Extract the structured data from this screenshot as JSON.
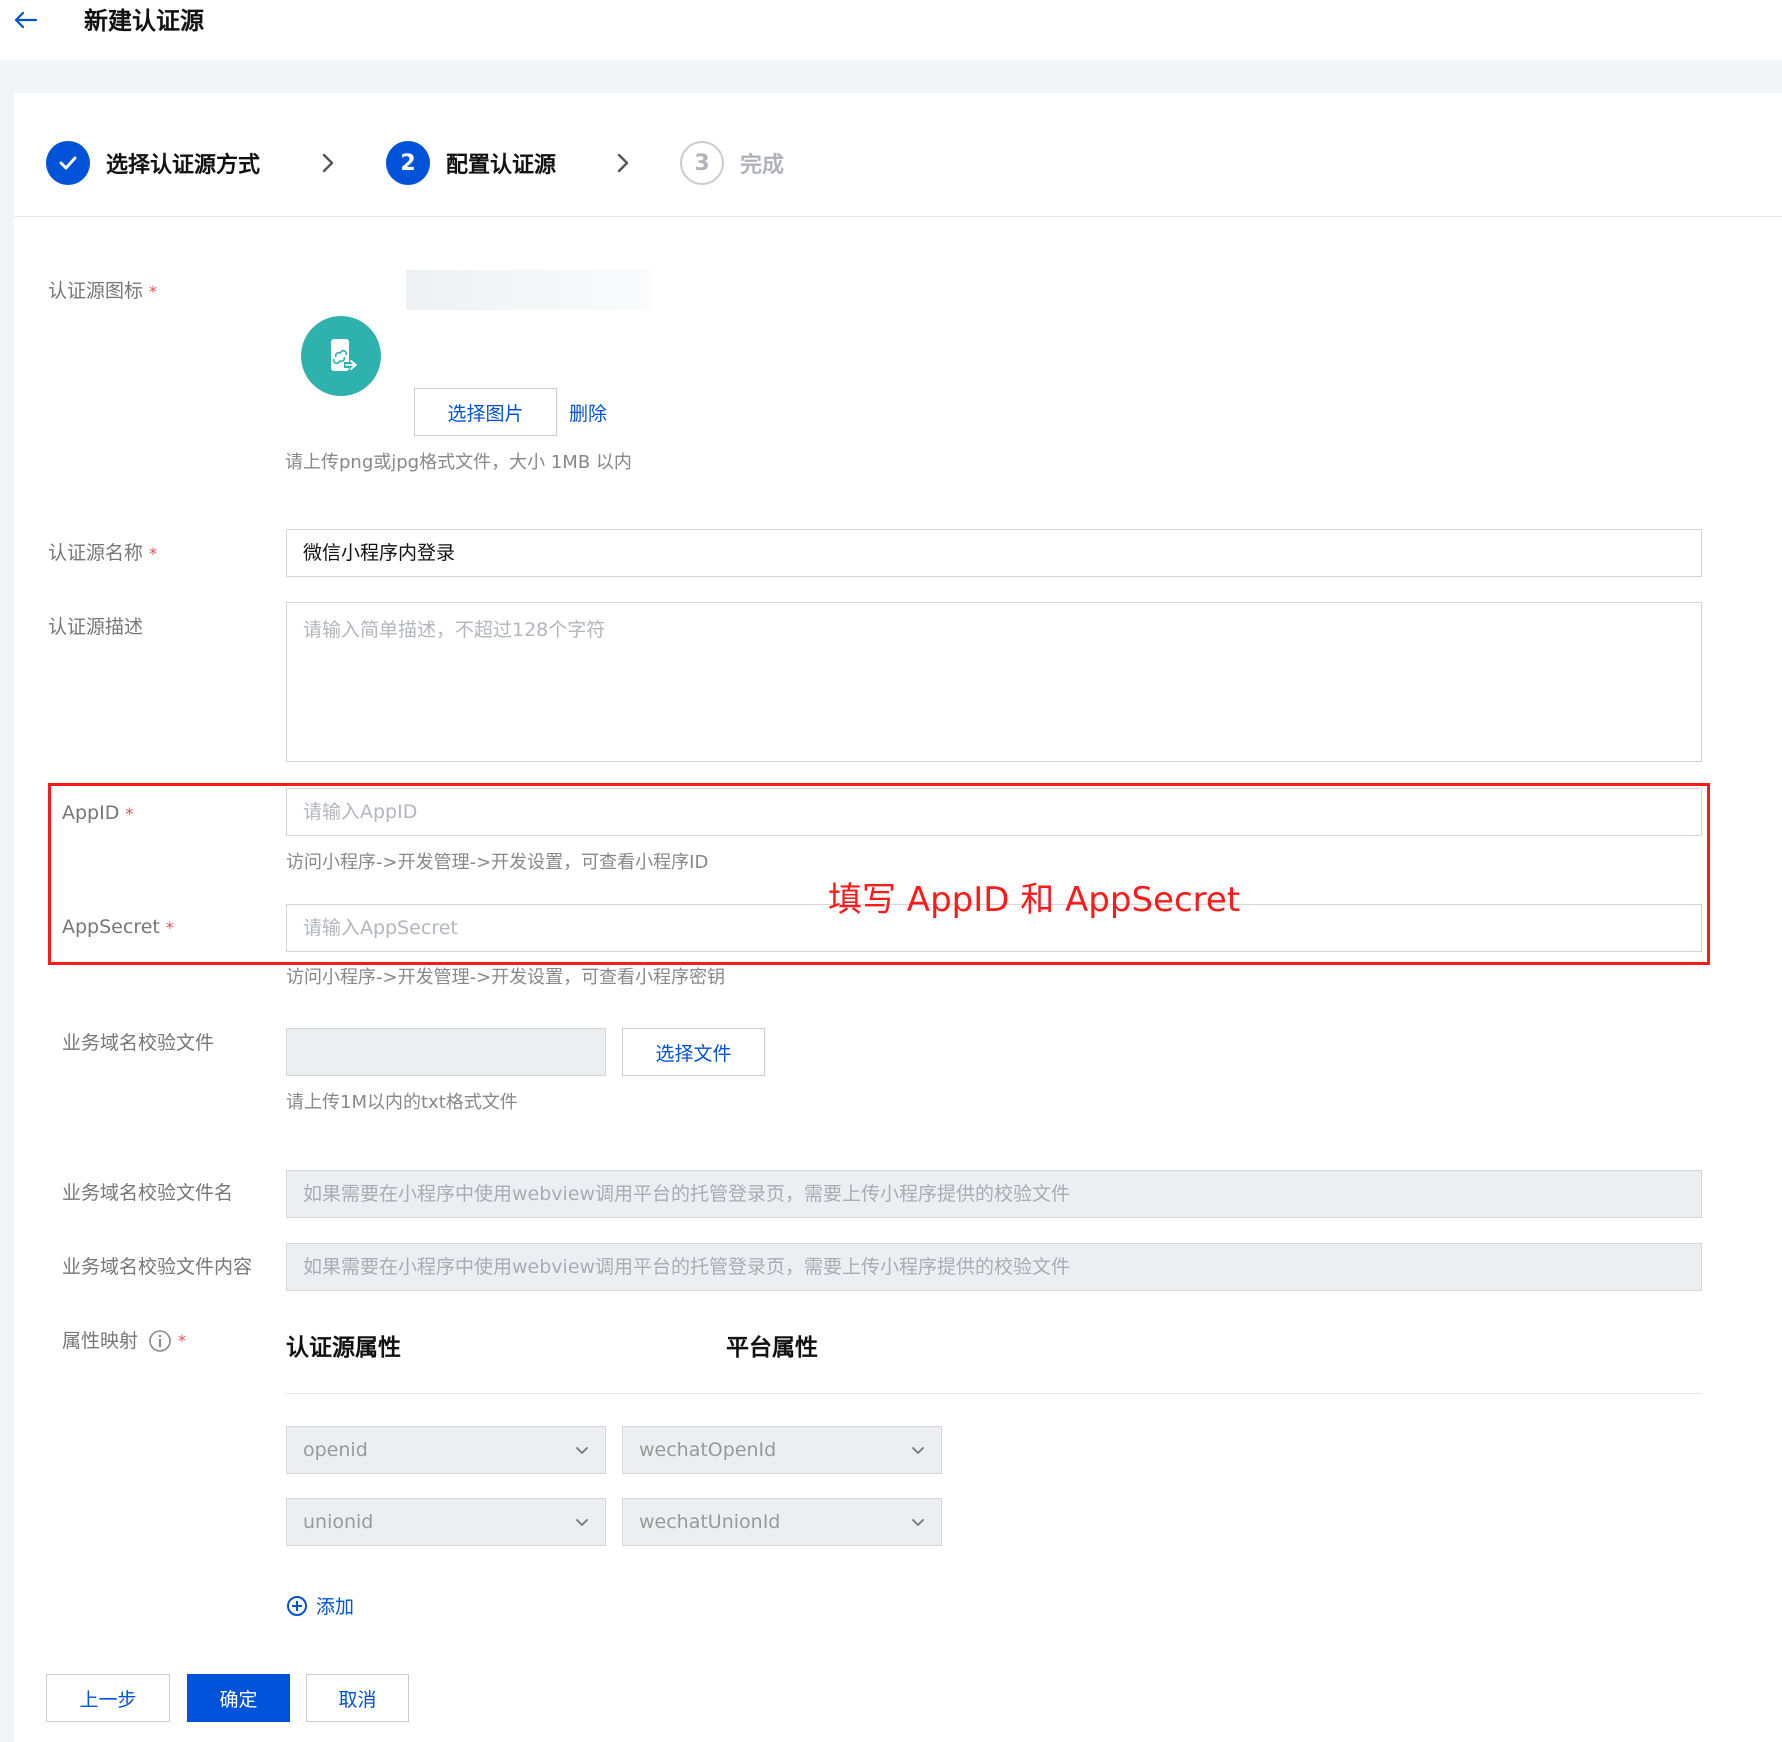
{
  "header": {
    "title": "新建认证源"
  },
  "steps": [
    {
      "label": "选择认证源方式",
      "state": "done",
      "marker": ""
    },
    {
      "label": "配置认证源",
      "state": "active",
      "marker": "2"
    },
    {
      "label": "完成",
      "state": "todo",
      "marker": "3"
    }
  ],
  "form": {
    "icon_field": {
      "label": "认证源图标",
      "required_mark": "*",
      "choose_image_label": "选择图片",
      "delete_label": "删除",
      "help": "请上传png或jpg格式文件，大小 1MB 以内",
      "icon_name": "phone-link-icon",
      "icon_color": "#2fb1ad"
    },
    "name_field": {
      "label": "认证源名称",
      "required_mark": "*",
      "value": "微信小程序内登录"
    },
    "desc_field": {
      "label": "认证源描述",
      "placeholder": "请输入简单描述，不超过128个字符"
    },
    "appid_field": {
      "label": "AppID",
      "required_mark": "*",
      "placeholder": "请输入AppID",
      "help": "访问小程序->开发管理->开发设置，可查看小程序ID"
    },
    "appsecret_field": {
      "label": "AppSecret",
      "required_mark": "*",
      "placeholder": "请输入AppSecret",
      "help": "访问小程序->开发管理->开发设置，可查看小程序密钥"
    },
    "verify_file_field": {
      "label": "业务域名校验文件",
      "choose_file_label": "选择文件",
      "help": "请上传1M以内的txt格式文件"
    },
    "verify_filename_field": {
      "label": "业务域名校验文件名",
      "placeholder": "如果需要在小程序中使用webview调用平台的托管登录页，需要上传小程序提供的校验文件"
    },
    "verify_content_field": {
      "label": "业务域名校验文件内容",
      "placeholder": "如果需要在小程序中使用webview调用平台的托管登录页，需要上传小程序提供的校验文件"
    },
    "mapping_field": {
      "label": "属性映射",
      "required_mark": "*",
      "source_header": "认证源属性",
      "platform_header": "平台属性",
      "rows": [
        {
          "source": "openid",
          "platform": "wechatOpenId"
        },
        {
          "source": "unionid",
          "platform": "wechatUnionId"
        }
      ],
      "add_label": "添加"
    }
  },
  "annotation": {
    "text": "填写 AppID 和 AppSecret",
    "color": "#ff1a1a"
  },
  "footer": {
    "prev_label": "上一步",
    "confirm_label": "确定",
    "cancel_label": "取消"
  },
  "colors": {
    "primary": "#0052d9",
    "required": "#e34d59"
  }
}
